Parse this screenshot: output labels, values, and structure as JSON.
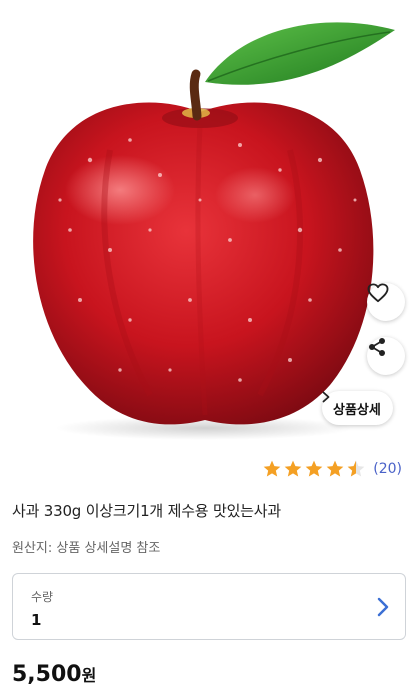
{
  "product": {
    "title": "사과 330g 이상크기1개 제수용 맛있는사과",
    "origin": "원산지: 상품 상세설명 참조",
    "detail_button_label": "상품상세",
    "rating": {
      "score": 4.5,
      "max": 5,
      "count_text": "(20)",
      "star_color": "#f4a024"
    },
    "quantity": {
      "label": "수량",
      "value": "1"
    },
    "price": {
      "amount": "5,500",
      "currency": "원"
    }
  },
  "icons": [
    "heart-icon",
    "share-icon",
    "chevron-right-icon",
    "star-icon"
  ],
  "colors": {
    "accent": "#3b6fd4",
    "rating_count": "#4a62c8",
    "apple_red": "#c8141e",
    "leaf_green": "#2f9a2a"
  }
}
